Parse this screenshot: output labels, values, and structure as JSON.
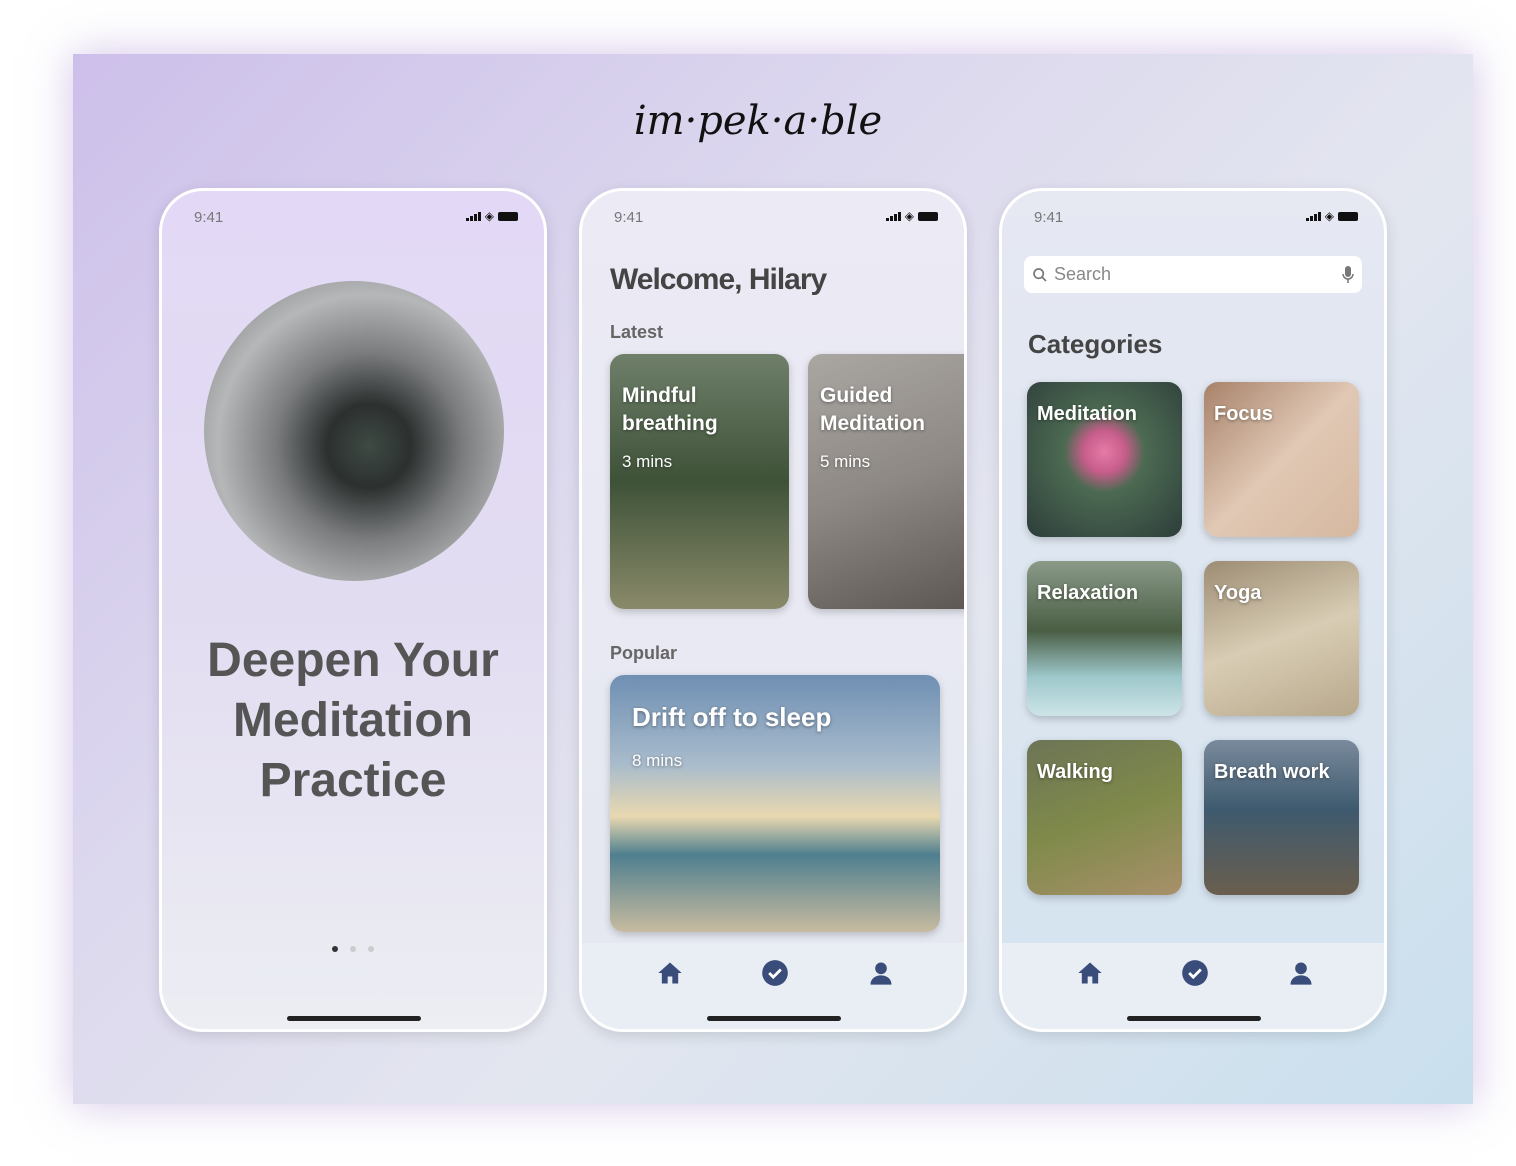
{
  "brand": {
    "logo": "im·pek·a·ble"
  },
  "status": {
    "time": "9:41"
  },
  "onboarding": {
    "title_lines": [
      "Deepen Your",
      "Meditation",
      "Practice"
    ],
    "page_count": 3,
    "current_page": 1
  },
  "home": {
    "welcome": "Welcome, Hilary",
    "latest_label": "Latest",
    "latest": [
      {
        "title": "Mindful breathing",
        "duration": "3 mins"
      },
      {
        "title": "Guided Meditation",
        "duration": "5 mins"
      }
    ],
    "popular_label": "Popular",
    "popular": {
      "title": "Drift off to sleep",
      "duration": "8 mins"
    }
  },
  "browse": {
    "search_placeholder": "Search",
    "categories_label": "Categories",
    "categories": [
      "Meditation",
      "Focus",
      "Relaxation",
      "Yoga",
      "Walking",
      "Breath work"
    ]
  },
  "tabbar": {
    "icons": [
      "home-icon",
      "check-circle-icon",
      "user-icon"
    ],
    "color": "#3a4d7a"
  }
}
